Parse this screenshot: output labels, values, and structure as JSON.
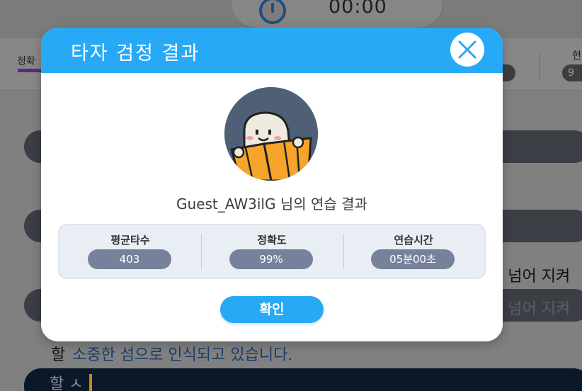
{
  "background": {
    "timer": "00:00",
    "stats_tab_label": "정확",
    "stats_right_label": "현",
    "stats_right_value": "9",
    "lines": [
      {
        "text": "을 넘어 지켜"
      },
      {
        "text": "을 넘어 지켜"
      }
    ],
    "previous_line_prefix": "할",
    "previous_line_rest": "소중한 섬으로 인식되고 있습니다.",
    "typing_text": "할 ㅅ"
  },
  "modal": {
    "title": "타자 검정 결과",
    "result_text": "Guest_AW3ilG 님의 연습 결과",
    "stats": [
      {
        "label": "평균타수",
        "value": "403"
      },
      {
        "label": "정확도",
        "value": "99%"
      },
      {
        "label": "연습시간",
        "value": "05분00초"
      }
    ],
    "confirm_label": "확인",
    "colors": {
      "header": "#27a9f6",
      "pill": "#76819b",
      "confirm": "#27a9f6"
    }
  }
}
